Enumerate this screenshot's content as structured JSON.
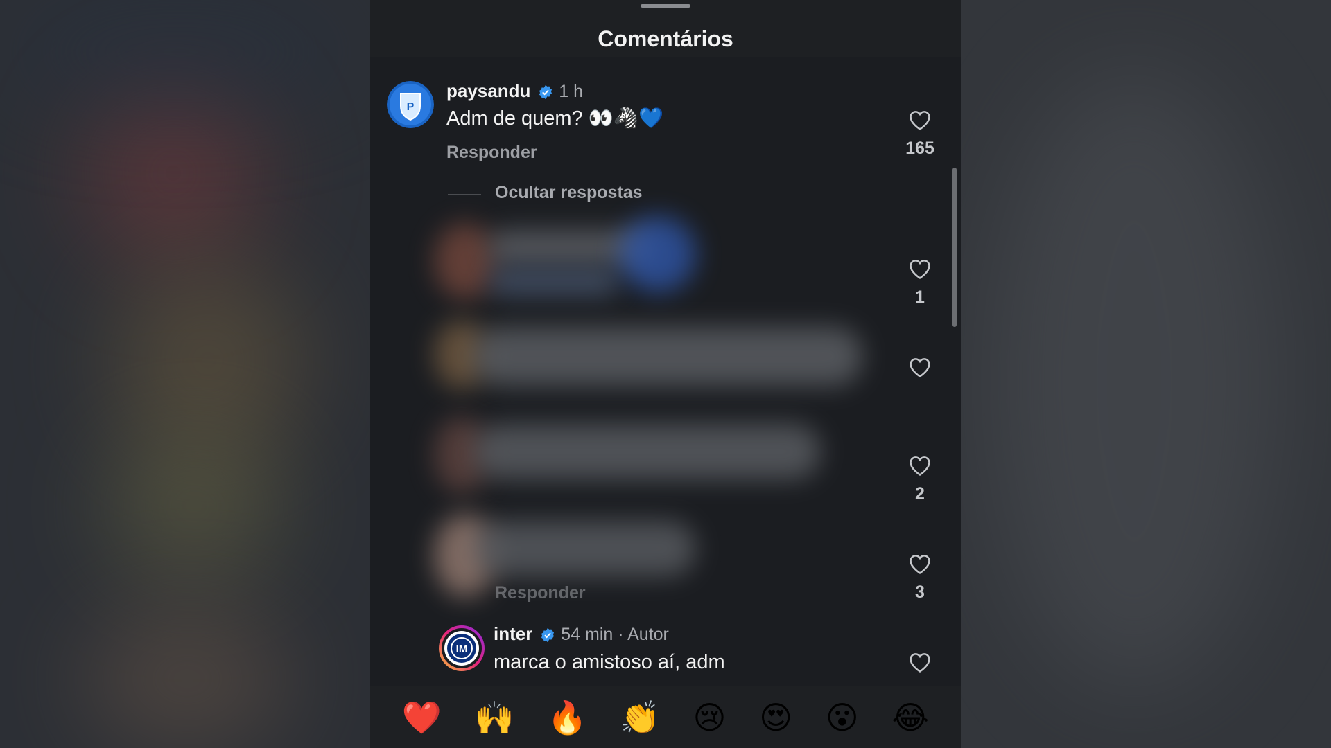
{
  "header": {
    "title": "Comentários"
  },
  "comments": [
    {
      "username": "paysandu",
      "time": "1 h",
      "text": "Adm de quem? 👀🦓💙",
      "reply_label": "Responder",
      "like_count": "165",
      "hide_replies_label": "Ocultar respostas"
    }
  ],
  "reply_like_counts": [
    "1",
    "",
    "2",
    "3"
  ],
  "reply_partial_label": "Responder",
  "author_reply": {
    "username": "inter",
    "time": "54 min · Autor",
    "text": "marca o amistoso aí, adm"
  },
  "reactions": [
    "❤️",
    "🙌",
    "🔥",
    "👏",
    "😢",
    "😍",
    "😮",
    "😂"
  ],
  "colors": {
    "verified": "#3897f0",
    "background": "#1b1d21",
    "text": "#f3f3f3",
    "muted": "#a9abb0"
  },
  "icons": [
    "heart-icon",
    "verified-badge-icon"
  ]
}
